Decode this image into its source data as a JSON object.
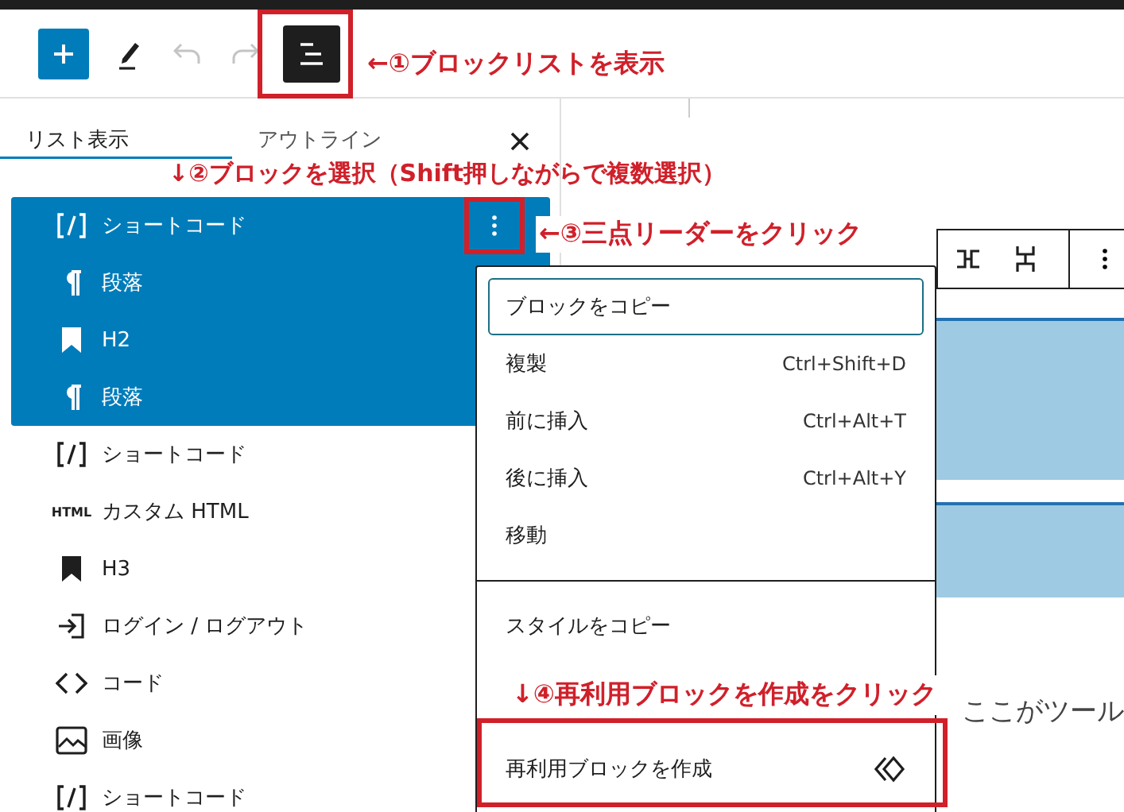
{
  "toolbar": {
    "buttons": [
      {
        "kind": "add",
        "disabled": false,
        "pressed": false
      },
      {
        "kind": "edit",
        "disabled": false,
        "pressed": false
      },
      {
        "kind": "undo",
        "disabled": true,
        "pressed": false
      },
      {
        "kind": "redo",
        "disabled": true,
        "pressed": false
      },
      {
        "kind": "list-view",
        "disabled": false,
        "pressed": true
      }
    ]
  },
  "list_view": {
    "tabs": [
      {
        "label": "リスト表示",
        "selected": true
      },
      {
        "label": "アウトライン",
        "selected": false
      }
    ],
    "blocks": [
      {
        "kind": "shortcode",
        "label": "ショートコード",
        "selected": true,
        "options_button": true
      },
      {
        "kind": "paragraph",
        "label": "段落",
        "selected": true,
        "options_button": false
      },
      {
        "kind": "heading",
        "label": "H2",
        "selected": true,
        "options_button": false
      },
      {
        "kind": "paragraph",
        "label": "段落",
        "selected": true,
        "options_button": false
      },
      {
        "kind": "shortcode",
        "label": "ショートコード",
        "selected": false,
        "options_button": false
      },
      {
        "kind": "html",
        "icon_text": "HTML",
        "label": "カスタム HTML",
        "selected": false,
        "options_button": false
      },
      {
        "kind": "heading",
        "label": "H3",
        "selected": false,
        "options_button": false
      },
      {
        "kind": "login",
        "label": "ログイン / ログアウト",
        "selected": false,
        "options_button": false
      },
      {
        "kind": "code",
        "label": "コード",
        "selected": false,
        "options_button": false
      },
      {
        "kind": "image",
        "label": "画像",
        "selected": false,
        "options_button": false
      },
      {
        "kind": "shortcode",
        "label": "ショートコード",
        "selected": false,
        "options_button": false
      }
    ]
  },
  "menu": {
    "sections": [
      [
        {
          "label": "ブロックをコピー",
          "focused": true
        },
        {
          "label": "複製",
          "shortcut": "Ctrl+Shift+D",
          "focused": false
        },
        {
          "label": "前に挿入",
          "shortcut": "Ctrl+Alt+T",
          "focused": false
        },
        {
          "label": "後に挿入",
          "shortcut": "Ctrl+Alt+Y",
          "focused": false
        },
        {
          "label": "移動",
          "focused": false
        }
      ],
      [
        {
          "label": "スタイルをコピー",
          "focused": false
        },
        {
          "label": "再利用ブロックを作成",
          "kind": "reusable",
          "focused": false,
          "highlighted": true
        }
      ]
    ]
  },
  "editor": {
    "text": "ここがツール"
  },
  "annotations": [
    {
      "kind": "step1",
      "text": "←①ブロックリストを表示"
    },
    {
      "kind": "step2",
      "text": "↓②ブロックを選択（Shift押しながらで複数選択）"
    },
    {
      "kind": "step3",
      "text": "←③三点リーダーをクリック"
    },
    {
      "kind": "step4",
      "text": "↓④再利用ブロックを作成をクリック"
    }
  ]
}
